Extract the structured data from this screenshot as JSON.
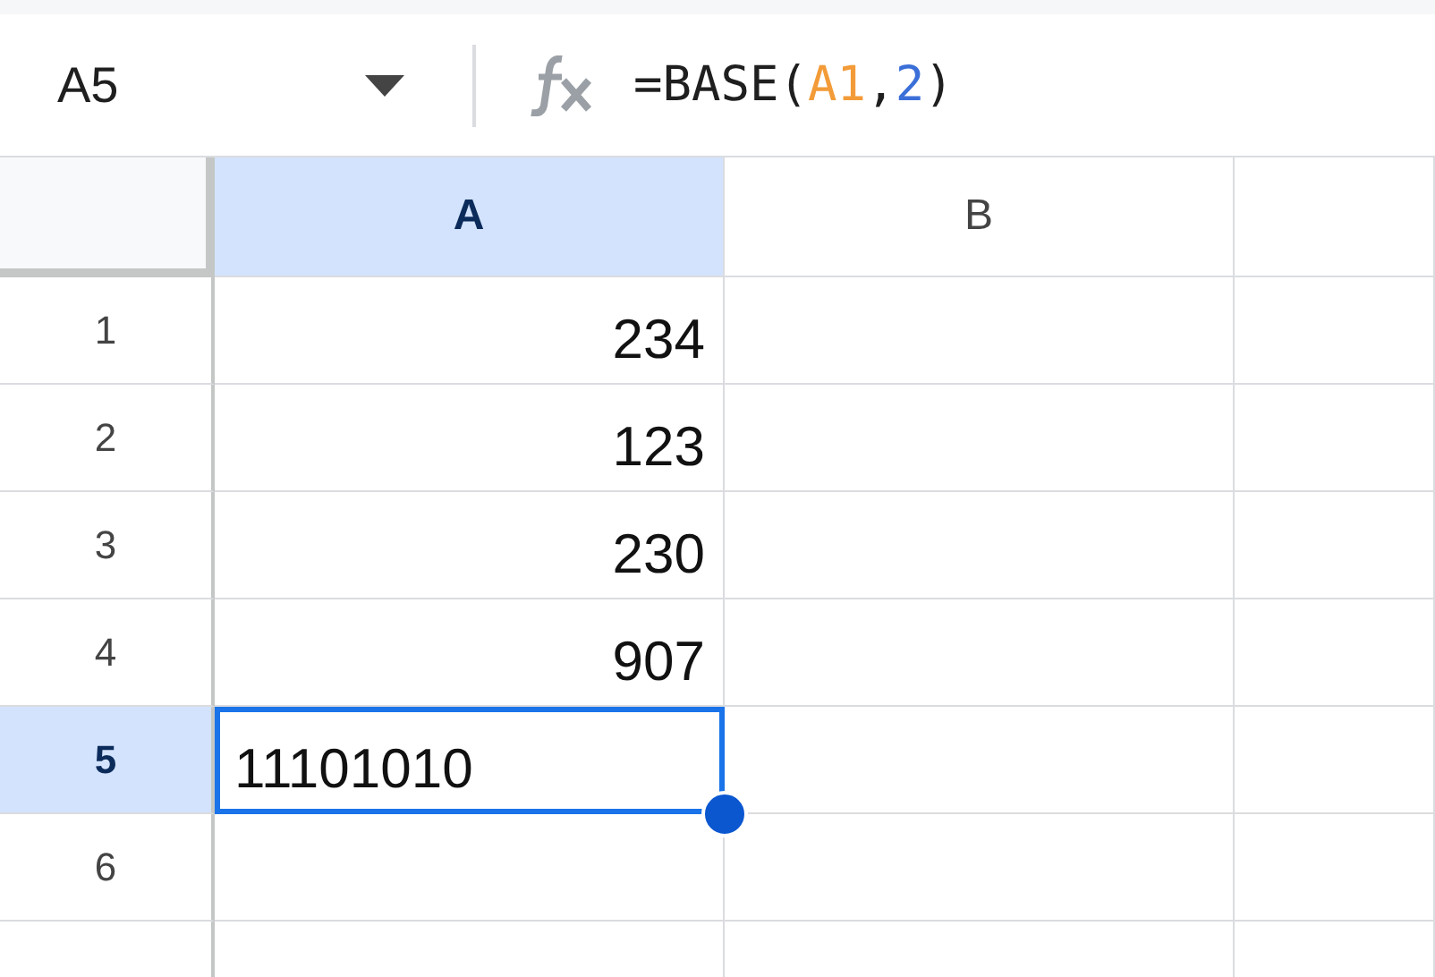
{
  "name_box": {
    "value": "A5"
  },
  "formula": [
    {
      "kind": "plain",
      "text": "=BASE("
    },
    {
      "kind": "ref",
      "text": "A1"
    },
    {
      "kind": "plain",
      "text": ","
    },
    {
      "kind": "number",
      "text": "2"
    },
    {
      "kind": "plain",
      "text": ")"
    }
  ],
  "columns": [
    {
      "label": "A",
      "selected": true
    },
    {
      "label": "B",
      "selected": false
    },
    {
      "selected": false
    }
  ],
  "rows": [
    {
      "label": "1",
      "selected": false,
      "cells": [
        {
          "value": "234",
          "active": false
        },
        {
          "active": false
        },
        {
          "active": false
        }
      ]
    },
    {
      "label": "2",
      "selected": false,
      "cells": [
        {
          "value": "123",
          "active": false
        },
        {
          "active": false
        },
        {
          "active": false
        }
      ]
    },
    {
      "label": "3",
      "selected": false,
      "cells": [
        {
          "value": "230",
          "active": false
        },
        {
          "active": false
        },
        {
          "active": false
        }
      ]
    },
    {
      "label": "4",
      "selected": false,
      "cells": [
        {
          "value": "907",
          "active": false
        },
        {
          "active": false
        },
        {
          "active": false
        }
      ]
    },
    {
      "label": "5",
      "selected": true,
      "cells": [
        {
          "value": "11101010",
          "active": true
        },
        {
          "active": false
        },
        {
          "active": false
        }
      ]
    },
    {
      "label": "6",
      "selected": false,
      "cells": [
        {
          "active": false
        },
        {
          "active": false
        },
        {
          "active": false
        }
      ]
    }
  ]
}
